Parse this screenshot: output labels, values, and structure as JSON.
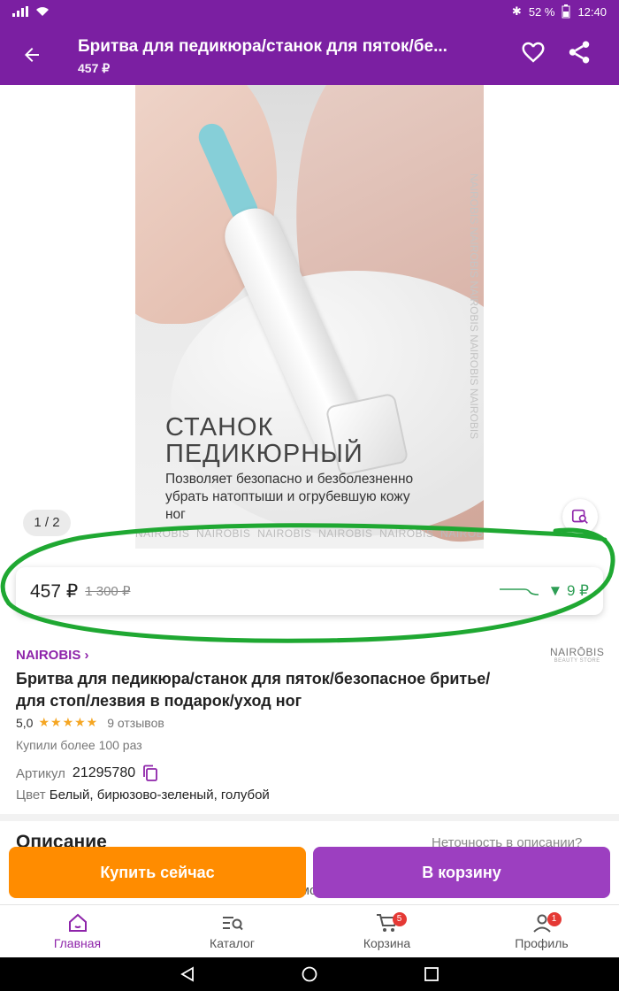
{
  "status_bar": {
    "battery": "52 %",
    "time": "12:40"
  },
  "header": {
    "title": "Бритва для педикюра/станок для пяток/бе...",
    "price": "457 ₽",
    "back_icon": "arrow-left-icon",
    "favorite_icon": "heart-icon",
    "share_icon": "share-icon"
  },
  "image": {
    "headline": "СТАНОК\nПЕДИКЮРНЫЙ",
    "subtitle": "Позволяет безопасно и безболезненно убрать натоптыши и огрубевшую кожу ног",
    "watermark": "NAIROBIS",
    "counter": "1 / 2"
  },
  "price_card": {
    "price": "457 ₽",
    "old_price": "1 300 ₽",
    "price_drop": "▼ 9 ₽"
  },
  "brand_logo": {
    "name": "NAIRŌBIS",
    "tagline": "BEAUTY STORE"
  },
  "product": {
    "brand": "NAIROBIS ›",
    "title": "Бритва для педикюра/станок для пяток/безопасное бритье/для стоп/лезвия в подарок/уход ног",
    "rating": "5,0",
    "stars": "★★★★★",
    "reviews": "9 отзывов",
    "bought": "Купили более 100 раз",
    "article_label": "Артикул",
    "article_value": "21295780",
    "color_label": "Цвет",
    "color_value": "Белый, бирюзово-зеленый, голубой"
  },
  "description": {
    "title": "Описание",
    "inaccuracy_link": "Неточность в описании?",
    "text_partial": "безболезненного удаления огрубевшей кожи, мозолей и натоптышей.В"
  },
  "actions": {
    "buy_now": "Купить сейчас",
    "add_to_cart": "В корзину"
  },
  "bottom_nav": [
    {
      "label": "Главная",
      "icon": "home-icon"
    },
    {
      "label": "Каталог",
      "icon": "catalog-search-icon"
    },
    {
      "label": "Корзина",
      "icon": "cart-icon",
      "badge": "5"
    },
    {
      "label": "Профиль",
      "icon": "profile-icon",
      "badge": "1"
    }
  ],
  "colors": {
    "primary": "#7b1fa2",
    "orange": "#ff8c00",
    "cart_button": "#9c3fc0",
    "price_drop": "#2e9e55",
    "annotation": "#1fa832"
  }
}
